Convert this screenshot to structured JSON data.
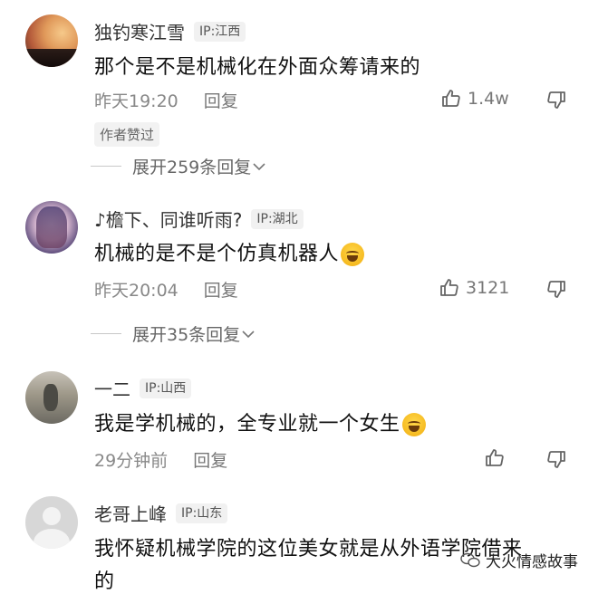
{
  "comments": [
    {
      "name": "独钓寒江雪",
      "ip": "IP:江西",
      "text": "那个是不是机械化在外面众筹请来的",
      "time": "昨天19:20",
      "reply": "回复",
      "likes": "1.4w",
      "badge": "作者赞过",
      "expand": "展开259条回复"
    },
    {
      "name": "♪檐下、同谁听雨?",
      "ip": "IP:湖北",
      "text": "机械的是不是个仿真机器人",
      "time": "昨天20:04",
      "reply": "回复",
      "likes": "3121",
      "expand": "展开35条回复"
    },
    {
      "name": "一二",
      "ip": "IP:山西",
      "text": "我是学机械的，全专业就一个女生",
      "time": "29分钟前",
      "reply": "回复"
    },
    {
      "name": "老哥上峰",
      "ip": "IP:山东",
      "text_line1": "我怀疑机械学院的这位美女就是从外语学院借来",
      "text_line2": "的"
    }
  ],
  "watermark": "大火情感故事",
  "icons": {
    "like": "thumbs-up-icon",
    "dislike": "thumbs-down-icon",
    "expand": "chevron-down-icon",
    "emoji": "laughing-tears-emoji-icon",
    "watermark": "wechat-icon"
  }
}
